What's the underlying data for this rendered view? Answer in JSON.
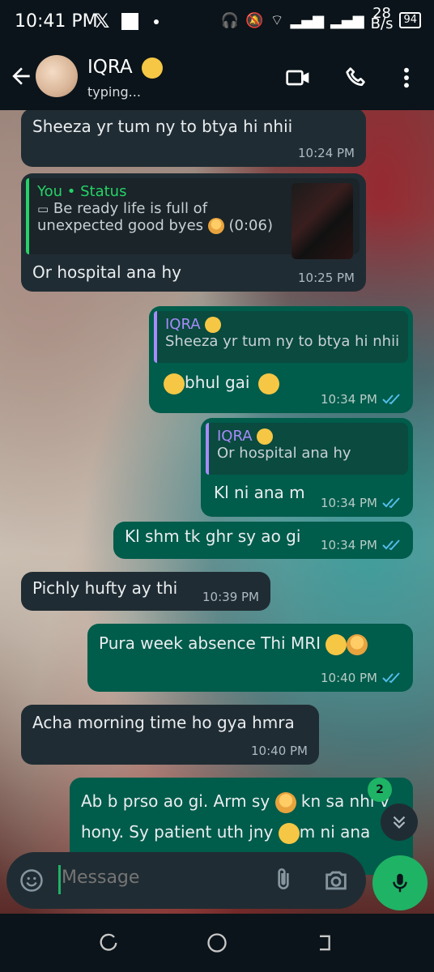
{
  "status_bar": {
    "time": "10:41 PM",
    "net_speed_value": "28",
    "net_speed_unit": "B/s",
    "battery": "94"
  },
  "header": {
    "contact_name": "IQRA",
    "status": "typing..."
  },
  "messages": [
    {
      "dir": "in",
      "text": "Sheeza yr tum ny to btya hi nhii",
      "time": "10:24 PM"
    },
    {
      "dir": "in",
      "quote_name": "You • Status",
      "quote_text_1": "Be ready life is full of",
      "quote_text_2": "unexpected good byes",
      "quote_duration": "(0:06)",
      "text": "Or hospital ana hy",
      "time": "10:25 PM"
    },
    {
      "dir": "out",
      "quote_name": "IQRA",
      "quote_text": "Sheeza yr tum ny to btya hi nhii",
      "text": "bhul gai",
      "time": "10:34 PM"
    },
    {
      "dir": "out",
      "quote_name": "IQRA",
      "quote_text": "Or hospital ana hy",
      "text": "Kl ni ana m",
      "time": "10:34 PM"
    },
    {
      "dir": "out",
      "text": "Kl shm tk ghr sy ao gi",
      "time": "10:34 PM"
    },
    {
      "dir": "in",
      "text": "Pichly hufty ay thi",
      "time": "10:39 PM"
    },
    {
      "dir": "out",
      "text": "Pura week absence Thi MRI",
      "time": "10:40 PM"
    },
    {
      "dir": "in",
      "text": "Acha morning time ho gya hmra",
      "time": "10:40 PM"
    },
    {
      "dir": "out",
      "text_1a": "Ab b prso ao gi. Arm sy",
      "text_1b": "kn sa nhi v",
      "text_2a": "hony. Sy patient uth jny",
      "text_2b": "m ni ana"
    }
  ],
  "unread_count": "2",
  "input": {
    "placeholder": "Message"
  },
  "colors": {
    "accent": "#1fb365",
    "outgoing": "#005c4b",
    "incoming": "#202c33",
    "quote_purple": "#a78bfa",
    "quote_green": "#25d366"
  }
}
